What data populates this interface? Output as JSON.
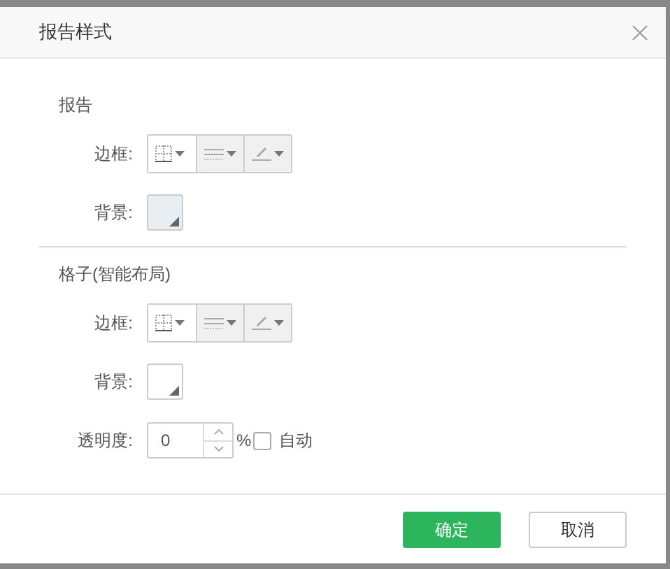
{
  "dialog": {
    "title": "报告样式"
  },
  "sections": [
    {
      "title": "报告",
      "rows": [
        {
          "kind": "border",
          "label": "边框:",
          "tools": [
            {
              "kind": "grid",
              "disabled": false
            },
            {
              "kind": "lines",
              "disabled": true
            },
            {
              "kind": "pen",
              "disabled": true
            }
          ]
        },
        {
          "kind": "background",
          "label": "背景:",
          "color": "#e8eef2"
        }
      ]
    },
    {
      "title": "格子(智能布局)",
      "rows": [
        {
          "kind": "border",
          "label": "边框:",
          "tools": [
            {
              "kind": "grid",
              "disabled": false
            },
            {
              "kind": "lines",
              "disabled": true
            },
            {
              "kind": "pen",
              "disabled": true
            }
          ]
        },
        {
          "kind": "background",
          "label": "背景:",
          "color": "#ffffff"
        },
        {
          "kind": "opacity",
          "label": "透明度:",
          "value": "0",
          "unit": "%",
          "checkbox": {
            "label": "自动",
            "checked": false
          }
        }
      ]
    }
  ],
  "buttons": [
    {
      "label": "确定",
      "primary": true
    },
    {
      "label": "取消",
      "primary": false
    }
  ]
}
